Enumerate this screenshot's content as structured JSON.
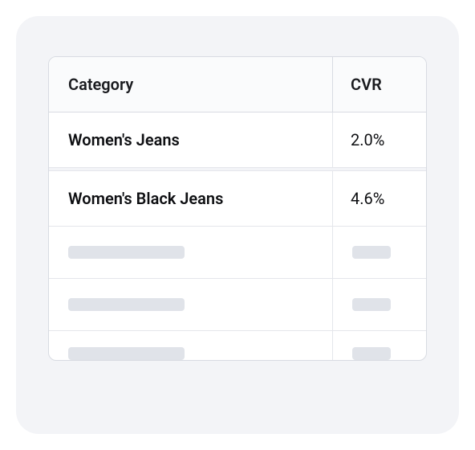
{
  "table": {
    "headers": {
      "category": "Category",
      "cvr": "CVR"
    },
    "rows": [
      {
        "category": "Women's Jeans",
        "cvr": "2.0%"
      },
      {
        "category": "Women's Black Jeans",
        "cvr": "4.6%"
      }
    ]
  }
}
